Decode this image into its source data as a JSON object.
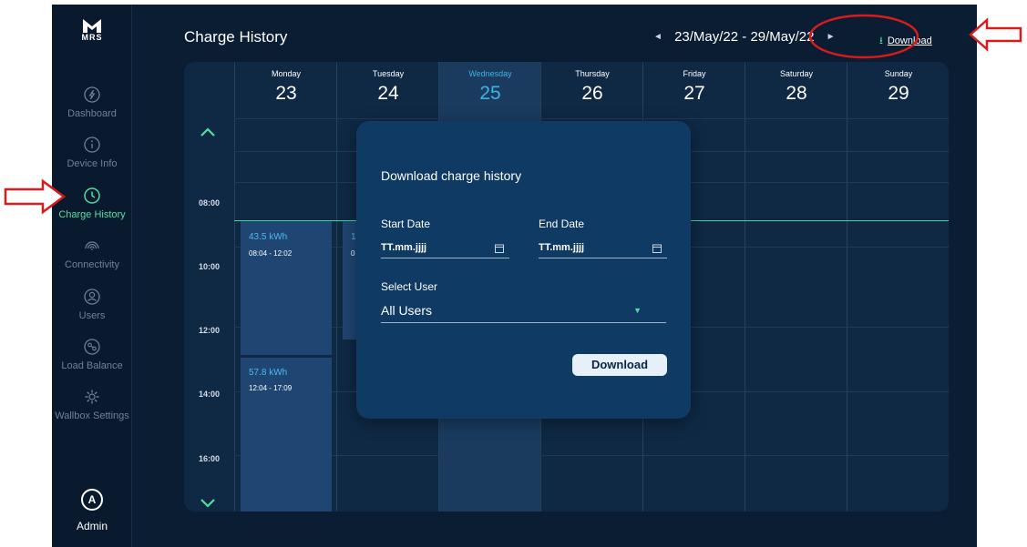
{
  "colors": {
    "accent_green": "#4fe0a4",
    "highlight_blue": "#3ab4e6",
    "background": "#0b1d33",
    "annotation_red": "#d81b1b"
  },
  "logo": {
    "text": "MRS"
  },
  "sidebar": {
    "items": [
      {
        "label": "Dashboard",
        "icon": "bolt-icon",
        "active": false
      },
      {
        "label": "Device Info",
        "icon": "info-icon",
        "active": false
      },
      {
        "label": "Charge History",
        "icon": "clock-icon",
        "active": true
      },
      {
        "label": "Connectivity",
        "icon": "signal-icon",
        "active": false
      },
      {
        "label": "Users",
        "icon": "user-icon",
        "active": false
      },
      {
        "label": "Load Balance",
        "icon": "load-balance-icon",
        "active": false
      },
      {
        "label": "Wallbox Settings",
        "icon": "gear-icon",
        "active": false
      }
    ],
    "user": {
      "initial": "A",
      "name": "Admin"
    }
  },
  "header": {
    "title": "Charge History",
    "date_range": "23/May/22 - 29/May/22",
    "prev_arrow": "◄",
    "next_arrow": "►",
    "download_icon": "⭳",
    "download_label": "Download"
  },
  "calendar": {
    "days": [
      {
        "name": "Monday",
        "num": "23",
        "highlight": false
      },
      {
        "name": "Tuesday",
        "num": "24",
        "highlight": false
      },
      {
        "name": "Wednesday",
        "num": "25",
        "highlight": true
      },
      {
        "name": "Thursday",
        "num": "26",
        "highlight": false
      },
      {
        "name": "Friday",
        "num": "27",
        "highlight": false
      },
      {
        "name": "Saturday",
        "num": "28",
        "highlight": false
      },
      {
        "name": "Sunday",
        "num": "29",
        "highlight": false
      }
    ],
    "times": [
      "08:00",
      "10:00",
      "12:00",
      "14:00",
      "16:00"
    ],
    "events": [
      {
        "kwh": "43.5 kWh",
        "time": "08:04 - 12:02"
      },
      {
        "kwh": "1",
        "time": "0"
      },
      {
        "kwh": "57.8 kWh",
        "time": "12:04 - 17:09"
      }
    ]
  },
  "modal": {
    "title": "Download charge history",
    "start_label": "Start Date",
    "start_value": "TT.mm.jjjj",
    "end_label": "End Date",
    "end_value": "TT.mm.jjjj",
    "user_label": "Select User",
    "user_value": "All Users",
    "caret": "▼",
    "button_label": "Download"
  }
}
